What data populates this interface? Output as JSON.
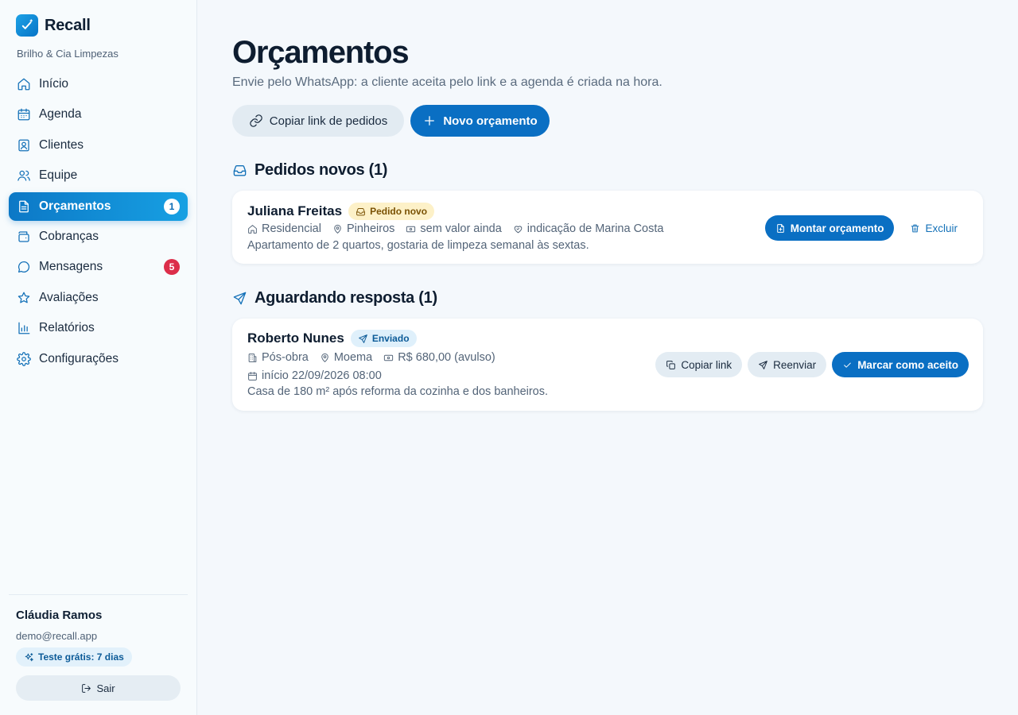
{
  "brand": {
    "name": "Recall",
    "company": "Brilho & Cia Limpezas"
  },
  "nav": [
    {
      "label": "Início",
      "icon": "home-icon"
    },
    {
      "label": "Agenda",
      "icon": "calendar-icon"
    },
    {
      "label": "Clientes",
      "icon": "contact-icon"
    },
    {
      "label": "Equipe",
      "icon": "users-icon"
    },
    {
      "label": "Orçamentos",
      "icon": "document-icon",
      "badge": "1",
      "active": true
    },
    {
      "label": "Cobranças",
      "icon": "wallet-icon"
    },
    {
      "label": "Mensagens",
      "icon": "message-icon",
      "badge": "5"
    },
    {
      "label": "Avaliações",
      "icon": "star-icon"
    },
    {
      "label": "Relatórios",
      "icon": "bar-chart-icon"
    },
    {
      "label": "Configurações",
      "icon": "gear-icon"
    }
  ],
  "user": {
    "name": "Cláudia Ramos",
    "email": "demo@recall.app",
    "trial": "Teste grátis: 7 dias",
    "logout": "Sair"
  },
  "page": {
    "title": "Orçamentos",
    "subtitle": "Envie pelo WhatsApp: a cliente aceita pelo link e a agenda é criada na hora.",
    "copy_orders_label": "Copiar link de pedidos",
    "new_quote_label": "Novo orçamento"
  },
  "new_requests": {
    "heading": "Pedidos novos (1)",
    "card": {
      "name": "Juliana Freitas",
      "tag": "Pedido novo",
      "type": "Residencial",
      "location": "Pinheiros",
      "value": "sem valor ainda",
      "referral": "indicação de Marina Costa",
      "description": "Apartamento de 2 quartos, gostaria de limpeza semanal às sextas.",
      "primary_action": "Montar orçamento",
      "secondary_action": "Excluir"
    }
  },
  "awaiting": {
    "heading": "Aguardando resposta (1)",
    "card": {
      "name": "Roberto Nunes",
      "tag": "Enviado",
      "type": "Pós-obra",
      "location": "Moema",
      "value": "R$ 680,00 (avulso)",
      "start": "início 22/09/2026 08:00",
      "description": "Casa de 180 m² após reforma da cozinha e dos banheiros.",
      "copy_action": "Copiar link",
      "resend_action": "Reenviar",
      "accept_action": "Marcar como aceito"
    }
  },
  "colors": {
    "accent": "#0a6fc3",
    "danger": "#dc2e4a",
    "pending_tag": "#fdf1c8",
    "sent_tag": "#dff0fb"
  }
}
